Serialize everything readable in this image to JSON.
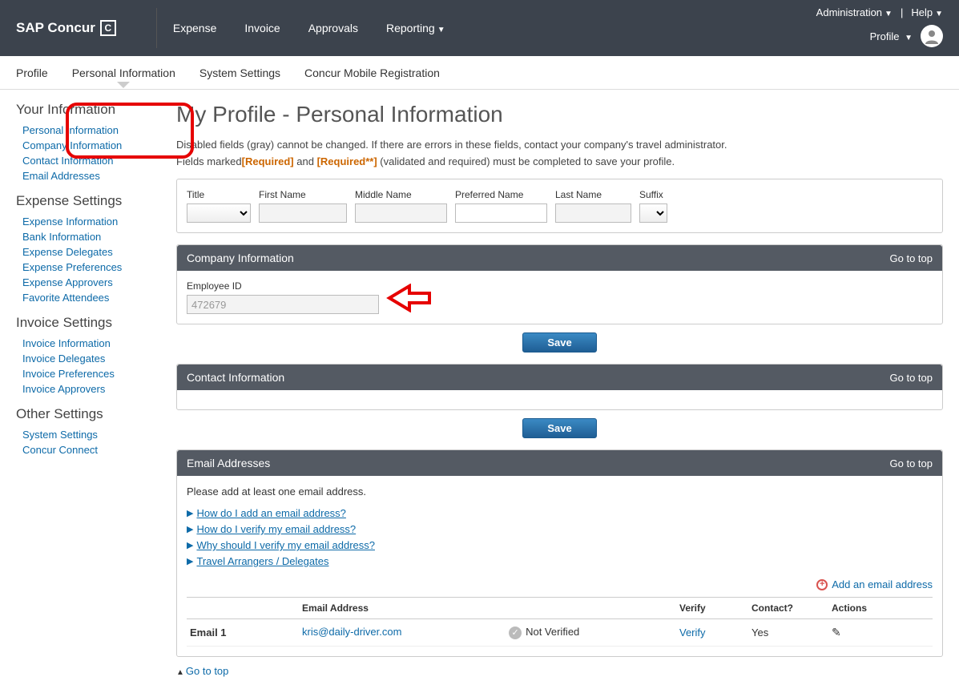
{
  "header": {
    "brand": "SAP Concur",
    "logo_letter": "C",
    "nav": {
      "expense": "Expense",
      "invoice": "Invoice",
      "approvals": "Approvals",
      "reporting": "Reporting"
    },
    "top_right": {
      "administration": "Administration",
      "help": "Help",
      "profile": "Profile"
    }
  },
  "subnav": {
    "profile": "Profile",
    "personal_info": "Personal Information",
    "system_settings": "System Settings",
    "concur_mobile": "Concur Mobile Registration"
  },
  "sidebar": {
    "your_info": {
      "title": "Your Information",
      "personal_info": "Personal Information",
      "company_info": "Company Information",
      "contact_info": "Contact Information",
      "email_addresses": "Email Addresses"
    },
    "expense": {
      "title": "Expense Settings",
      "expense_info": "Expense Information",
      "bank_info": "Bank Information",
      "delegates": "Expense Delegates",
      "preferences": "Expense Preferences",
      "approvers": "Expense Approvers",
      "favorite_attendees": "Favorite Attendees"
    },
    "invoice": {
      "title": "Invoice Settings",
      "info": "Invoice Information",
      "delegates": "Invoice Delegates",
      "preferences": "Invoice Preferences",
      "approvers": "Invoice Approvers"
    },
    "other": {
      "title": "Other Settings",
      "system_settings": "System Settings",
      "concur_connect": "Concur Connect"
    }
  },
  "main": {
    "title": "My Profile - Personal Information",
    "desc1": "Disabled fields (gray) cannot be changed. If there are errors in these fields, contact your company's travel administrator.",
    "desc2_prefix": "Fields marked",
    "req1": "[Required]",
    "desc2_mid": " and ",
    "req2": "[Required**]",
    "desc2_suffix": " (validated and required) must be completed to save your profile.",
    "name_fields": {
      "title_label": "Title",
      "first_label": "First Name",
      "middle_label": "Middle Name",
      "preferred_label": "Preferred Name",
      "last_label": "Last Name",
      "suffix_label": "Suffix"
    },
    "company_section": {
      "heading": "Company Information",
      "go_top": "Go to top",
      "employee_id_label": "Employee ID",
      "employee_id_value": "472679",
      "save_label": "Save"
    },
    "contact_section": {
      "heading": "Contact Information",
      "go_top": "Go to top",
      "save_label": "Save"
    },
    "email_section": {
      "heading": "Email Addresses",
      "go_top": "Go to top",
      "instruction": "Please add at least one email address.",
      "faq1": "How do I add an email address?",
      "faq2": "How do I verify my email address?",
      "faq3": "Why should I verify my email address?",
      "faq4": "Travel Arrangers / Delegates",
      "add_link": "Add an email address",
      "col_email": "Email Address",
      "col_verify": "Verify",
      "col_contact": "Contact?",
      "col_actions": "Actions",
      "row1_label": "Email 1",
      "row1_email": "kris@daily-driver.com",
      "row1_status": "Not Verified",
      "row1_verify": "Verify",
      "row1_contact": "Yes"
    },
    "go_top_bottom": "Go to top"
  }
}
